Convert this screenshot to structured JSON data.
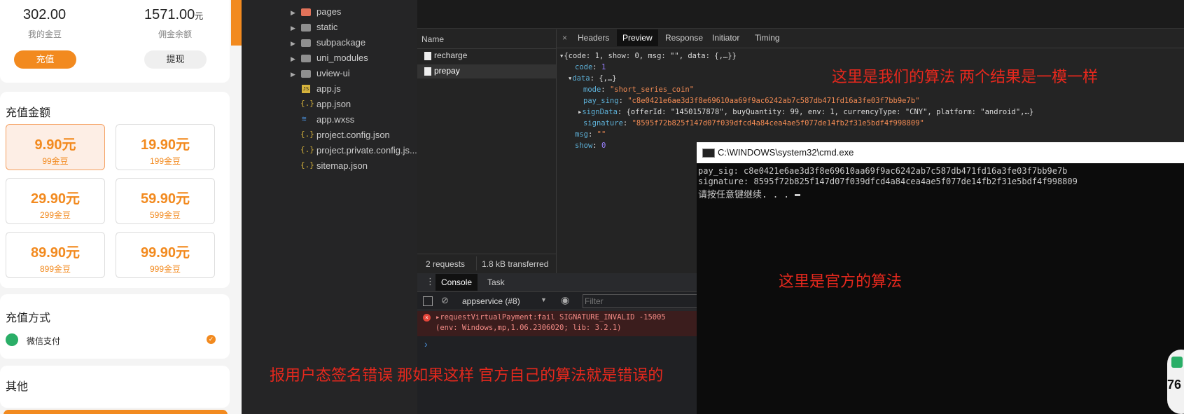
{
  "phone": {
    "balance_value": "302.00",
    "balance_label": "我的金豆",
    "commission_value": "1571.00",
    "commission_unit": "元",
    "commission_label": "佣金余额",
    "recharge_button": "充值",
    "withdraw_button": "提现",
    "section_amount": "充值金额",
    "amounts": [
      {
        "price": "9.90元",
        "coins": "99金豆"
      },
      {
        "price": "19.90元",
        "coins": "199金豆"
      },
      {
        "price": "29.90元",
        "coins": "299金豆"
      },
      {
        "price": "59.90元",
        "coins": "599金豆"
      },
      {
        "price": "89.90元",
        "coins": "899金豆"
      },
      {
        "price": "99.90元",
        "coins": "999金豆"
      }
    ],
    "section_method": "充值方式",
    "wechat_pay": "微信支付",
    "section_other": "其他"
  },
  "explorer": {
    "items": [
      "pages",
      "static",
      "subpackage",
      "uni_modules",
      "uview-ui",
      "app.js",
      "app.json",
      "app.wxss",
      "project.config.json",
      "project.private.config.js...",
      "sitemap.json"
    ]
  },
  "network": {
    "name_header": "Name",
    "requests": [
      "recharge",
      "prepay"
    ],
    "tabs": [
      "Headers",
      "Preview",
      "Response",
      "Initiator",
      "Timing"
    ],
    "footer_requests": "2 requests",
    "footer_transferred": "1.8 kB transferred",
    "preview": {
      "line1": "{code: 1, show: 0, msg: \"\", data: {,…}}",
      "code_key": "code",
      "code_val": "1",
      "data_key": "data",
      "data_val": "{,…}",
      "mode_key": "mode",
      "mode_val": "\"short_series_coin\"",
      "pay_key": "pay_sing",
      "pay_val": "\"c8e0421e6ae3d3f8e69610aa69f9ac6242ab7c587db471fd16a3fe03f7bb9e7b\"",
      "sign_key": "signData",
      "sign_val": "{offerId: \"1450157878\", buyQuantity: 99, env: 1, currencyType: \"CNY\", platform: \"android\",…}",
      "sig_key": "signature",
      "sig_val": "\"8595f72b825f147d07f039dfcd4a84cea4ae5f077de14fb2f31e5bdf4f998809\"",
      "msg_key": "msg",
      "msg_val": "\"\"",
      "show_key": "show",
      "show_val": "0"
    }
  },
  "console": {
    "tabs": [
      "Console",
      "Task"
    ],
    "context": "appservice (#8)",
    "filter_placeholder": "Filter",
    "error_line1": "requestVirtualPayment:fail SIGNATURE_INVALID -15005",
    "error_line2": "(env: Windows,mp,1.06.2306020; lib: 3.2.1)",
    "prompt": "›"
  },
  "cmd": {
    "title": "C:\\WINDOWS\\system32\\cmd.exe",
    "line1": "pay_sig: c8e0421e6ae3d3f8e69610aa69f9ac6242ab7c587db471fd16a3fe03f7bb9e7b",
    "line2": "signature: 8595f72b825f147d07f039dfcd4a84cea4ae5f077de14fb2f31e5bdf4f998809",
    "line3": "请按任意键继续. . ."
  },
  "annotations": {
    "ours": "这里是我们的算法 两个结果是一模一样",
    "official": "这里是官方的算法",
    "error_note": "报用户态签名错误 那如果这样 官方自己的算法就是错误的"
  },
  "badge_number": "76",
  "colors": {
    "accent": "#f28a1f",
    "annotation": "#e5281d",
    "wechat": "#2aae67"
  }
}
